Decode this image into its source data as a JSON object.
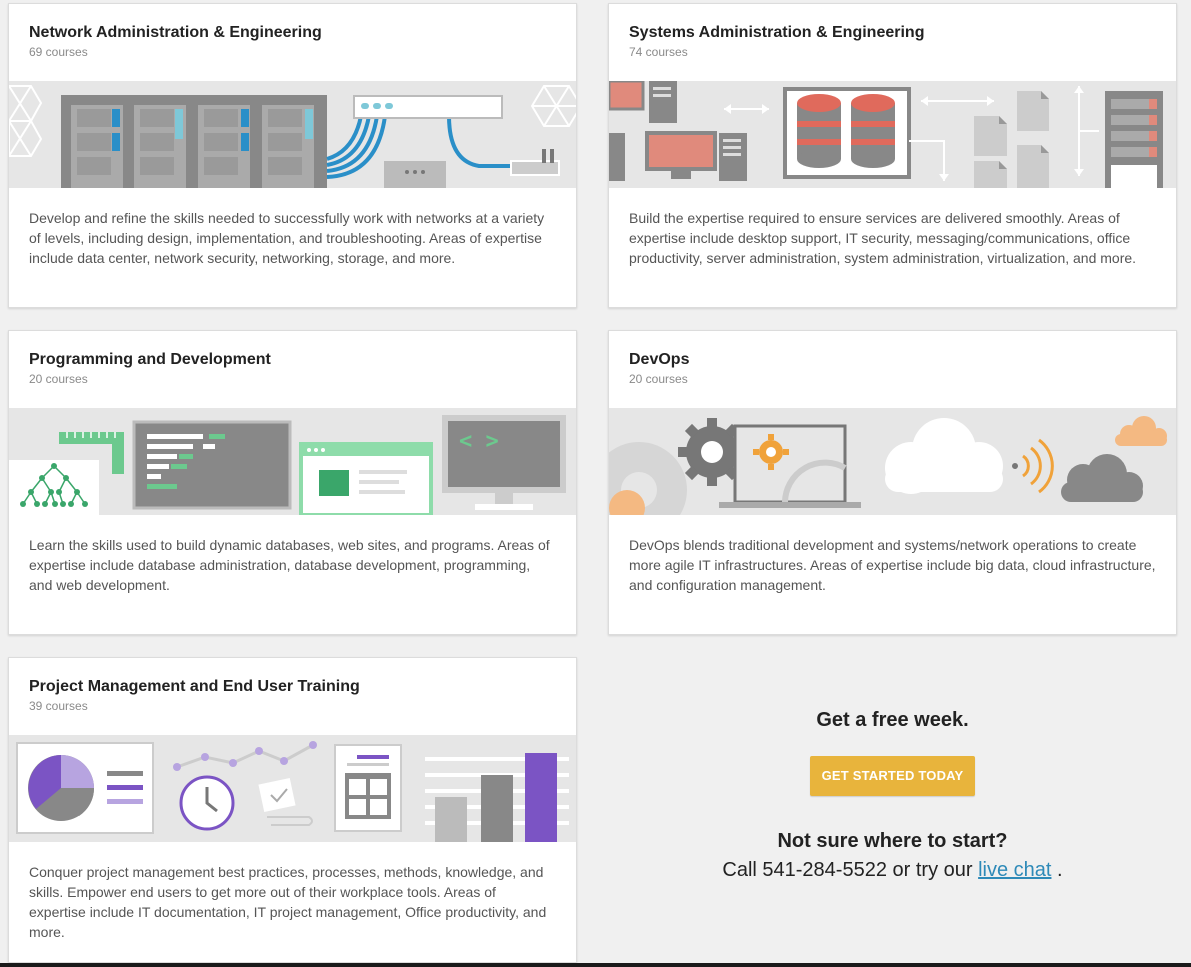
{
  "cards": [
    {
      "title": "Network Administration & Engineering",
      "count": "69 courses",
      "description": "Develop and refine the skills needed to successfully work with networks at a variety of levels, including design, implementation, and troubleshooting. Areas of expertise include data center, network security, networking, storage, and more.",
      "illustration": "network-illustration"
    },
    {
      "title": "Systems Administration & Engineering",
      "count": "74 courses",
      "description": "Build the expertise required to ensure services are delivered smoothly. Areas of expertise include desktop support, IT security, messaging/communications, office productivity, server administration, system administration, virtualization, and more.",
      "illustration": "systems-illustration"
    },
    {
      "title": "Programming and Development",
      "count": "20 courses",
      "description": "Learn the skills used to build dynamic databases, web sites, and programs. Areas of expertise include database administration, database development, programming, and web development.",
      "illustration": "programming-illustration"
    },
    {
      "title": "DevOps",
      "count": "20 courses",
      "description": "DevOps blends traditional development and systems/network operations to create more agile IT infrastructures. Areas of expertise include big data, cloud infrastructure, and configuration management.",
      "illustration": "devops-illustration"
    },
    {
      "title": "Project Management and End User Training",
      "count": "39 courses",
      "description": "Conquer project management best practices, processes, methods, knowledge, and skills. Empower end users to get more out of their workplace tools. Areas of expertise include IT documentation, IT project management, Office productivity, and more.",
      "illustration": "project-management-illustration"
    }
  ],
  "cta": {
    "headline": "Get a free week.",
    "button_label": "GET STARTED TODAY",
    "question": "Not sure where to start?",
    "call_prefix": "Call 541-284-5522 or try our",
    "chat_link": "live chat",
    "call_suffix": "."
  },
  "colors": {
    "background": "#f0f0f0",
    "card": "#ffffff",
    "illustration_bg": "#e6e6e6",
    "button": "#e8b43c",
    "link": "#2e8ab8",
    "accent_blue": "#2a8fc8",
    "accent_red": "#e06a5c",
    "accent_green": "#6cc98e",
    "accent_orange": "#f0a23a",
    "accent_purple": "#7b54c4"
  }
}
